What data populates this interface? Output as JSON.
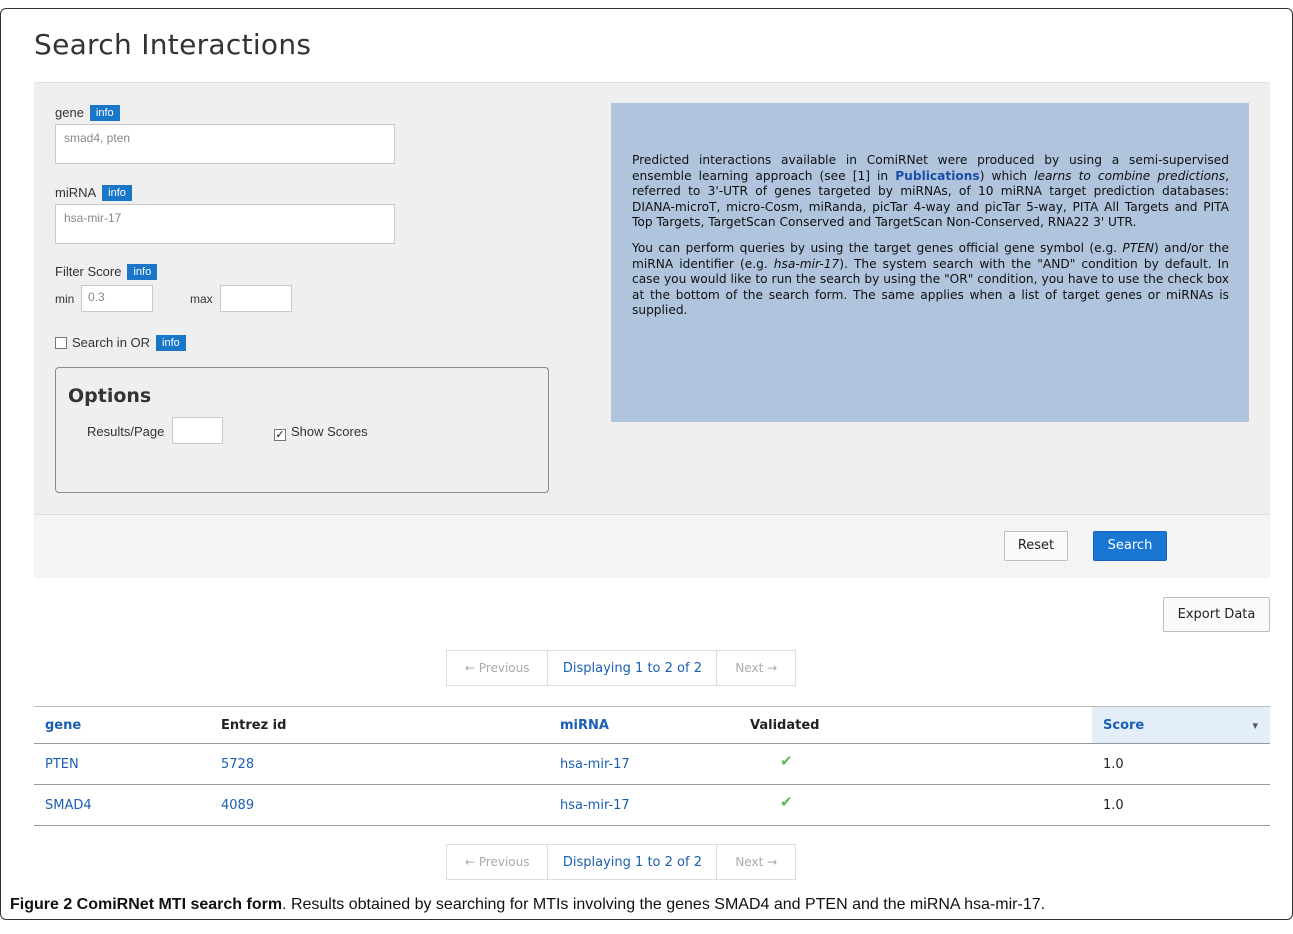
{
  "page": {
    "title": "Search Interactions"
  },
  "form": {
    "gene_label": "gene",
    "gene_value": "smad4, pten",
    "mirna_label": "miRNA",
    "mirna_value": "hsa-mir-17",
    "filter_label": "Filter Score",
    "min_label": "min",
    "min_value": "0.3",
    "max_label": "max",
    "max_value": "",
    "search_or_label": "Search in OR",
    "info_badge": "info"
  },
  "options": {
    "title": "Options",
    "results_label": "Results/Page",
    "results_value": "",
    "show_scores_label": "Show Scores"
  },
  "info_text": {
    "p1_a": "Predicted interactions available in ComiRNet were produced by using a semi-supervised ensemble learning approach (see [1] in ",
    "p1_link": "Publications",
    "p1_b": ") which ",
    "p1_italic": "learns to combine predictions",
    "p1_c": ", referred to 3'-UTR of genes targeted by miRNAs, of 10 miRNA target prediction databases: DIANA-microT, micro-Cosm, miRanda, picTar 4-way and picTar 5-way, PITA All Targets and PITA Top Targets, TargetScan Conserved and TargetScan Non-Conserved, RNA22 3' UTR.",
    "p2_a": "You can perform queries by using the target genes official gene symbol (e.g. ",
    "p2_i1": "PTEN",
    "p2_b": ") and/or the miRNA identifier (e.g. ",
    "p2_i2": "hsa-mir-17",
    "p2_c": "). The system search with the \"AND\" condition by default. In case you would like to run the search by using the \"OR\" condition, you have to use the check box at the bottom of the search form. The same applies when a list of target genes or miRNAs is supplied."
  },
  "buttons": {
    "reset": "Reset",
    "search": "Search",
    "export": "Export Data"
  },
  "pager": {
    "prev": "← Previous",
    "display": "Displaying 1 to 2 of 2",
    "next": "Next →"
  },
  "table": {
    "headers": [
      "gene",
      "Entrez id",
      "miRNA",
      "Validated",
      "Score"
    ],
    "rows": [
      {
        "gene": "PTEN",
        "entrez": "5728",
        "mirna": "hsa-mir-17",
        "validated": "✔",
        "score": "1.0"
      },
      {
        "gene": "SMAD4",
        "entrez": "4089",
        "mirna": "hsa-mir-17",
        "validated": "✔",
        "score": "1.0"
      }
    ],
    "sort_icon": "▾"
  },
  "caption": {
    "bold": "Figure 2 ComiRNet MTI search form",
    "rest": ". Results obtained by searching for MTIs involving the genes SMAD4 and PTEN and the miRNA hsa-mir-17."
  },
  "colors": {
    "accent": "#1976d2",
    "info_bg": "#b0c4de",
    "link": "#1a5fb4",
    "check": "#5cb85c"
  }
}
